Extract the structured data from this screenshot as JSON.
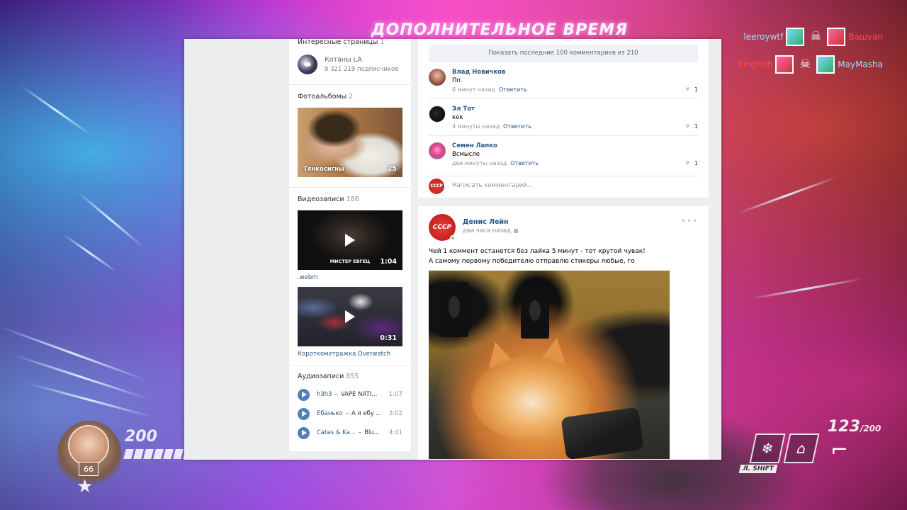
{
  "game": {
    "banner": "ДОПОЛНИТЕЛЬНОЕ ВРЕМЯ",
    "killfeed": [
      {
        "killer": "leeroywtf",
        "victim": "Вашvan"
      },
      {
        "killer": "KingFish",
        "victim": "MayMasha"
      }
    ],
    "hud": {
      "health": "200",
      "health_max": "/ 200",
      "hero_level": "66",
      "ammo": "123",
      "ammo_max": "/200",
      "ability_key": "Л. SHIFT"
    }
  },
  "vk": {
    "left": {
      "pages_header": "Интересные страницы",
      "pages_count": "1",
      "group": {
        "name": "Котаны LA",
        "subscribers": "9 321 219 подписчиков"
      },
      "albums_header": "Фотоальбомы",
      "albums_count": "2",
      "album": {
        "caption": "Тянкосигны",
        "count": "25"
      },
      "videos_header": "Видеозаписи",
      "videos_count": "186",
      "videos": [
        {
          "title": ".webm",
          "overlay": "МИСТЕР ЕВГЕЦ",
          "duration": "1:04"
        },
        {
          "title": "Короткометражка Overwatch",
          "overlay": "",
          "duration": "0:31"
        }
      ],
      "audio_header": "Аудиозаписи",
      "audio_count": "855",
      "audio": [
        {
          "artist": "h3h3",
          "title": "VAPE NATI...",
          "duration": "1:07"
        },
        {
          "artist": "Ебанько",
          "title": "А я ебу ...",
          "duration": "3:02"
        },
        {
          "artist": "Catas & Ka...",
          "title": "Blu...",
          "duration": "4:41"
        }
      ]
    },
    "comments": {
      "show_more": "Показать последние 100 комментариев из 210",
      "items": [
        {
          "author": "Влад Новичков",
          "text": "Пп",
          "time": "6 минут назад",
          "reply": "Ответить",
          "likes": "1"
        },
        {
          "author": "Эл Тот",
          "text": "кек",
          "time": "4 минуты назад",
          "reply": "Ответить",
          "likes": "1"
        },
        {
          "author": "Семен Лапко",
          "text": "Всмысле",
          "time": "две минуты назад",
          "reply": "Ответить",
          "likes": "1"
        }
      ],
      "input_placeholder": "Написать комментарий..."
    },
    "post": {
      "author": "Денис Лейн",
      "time": "два часа назад",
      "avatar_text": "СССР",
      "text_line1": "Чей 1 коммент останется без лайка 5 минут - тот крутой чувак!",
      "text_line2": "А самому первому победителю отправлю стикеры любые, го"
    }
  }
}
